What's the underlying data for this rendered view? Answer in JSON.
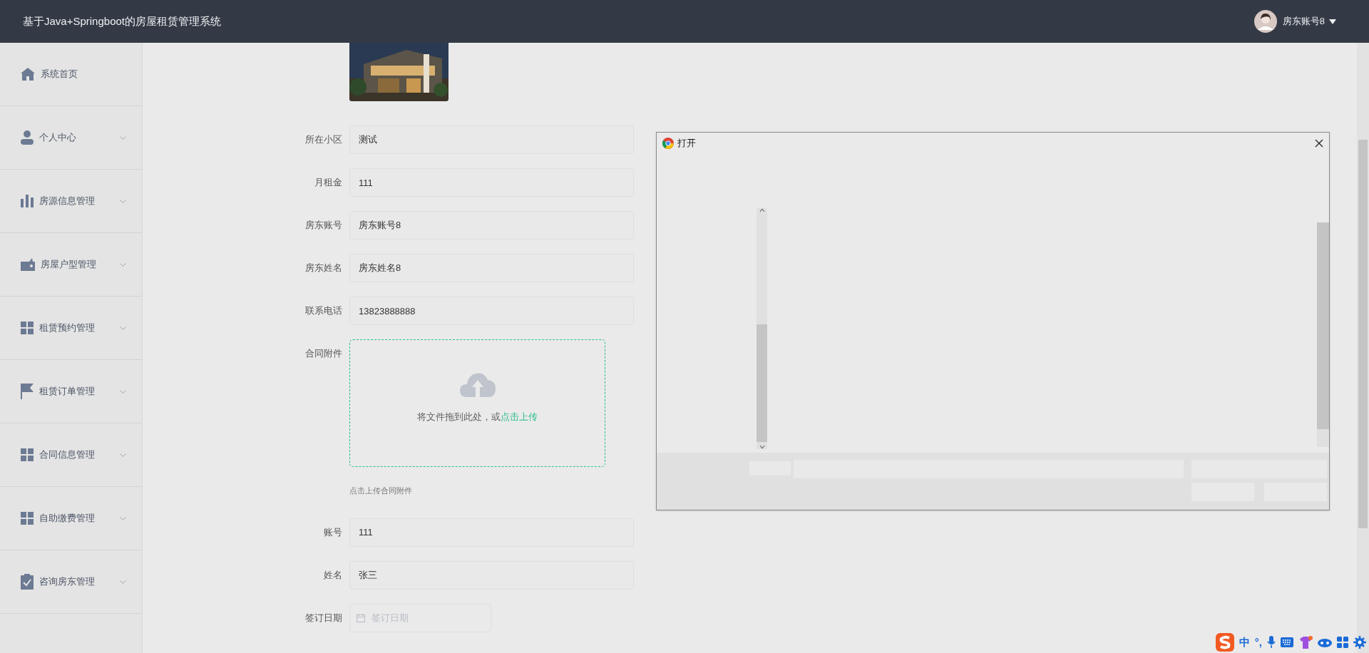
{
  "header": {
    "title": "基于Java+Springboot的房屋租赁管理系统",
    "user": "房东账号8"
  },
  "sidebar": {
    "items": [
      {
        "label": "系统首页",
        "kind": "home",
        "submenu": false
      },
      {
        "label": "个人中心",
        "kind": "user",
        "submenu": true
      },
      {
        "label": "房源信息管理",
        "kind": "chart",
        "submenu": true
      },
      {
        "label": "房屋户型管理",
        "kind": "wallet",
        "submenu": true
      },
      {
        "label": "租赁预约管理",
        "kind": "grid",
        "submenu": true
      },
      {
        "label": "租赁订单管理",
        "kind": "flag",
        "submenu": true
      },
      {
        "label": "合同信息管理",
        "kind": "grid",
        "submenu": true
      },
      {
        "label": "自助缴费管理",
        "kind": "grid",
        "submenu": true
      },
      {
        "label": "咨询房东管理",
        "kind": "clipboard",
        "submenu": true
      }
    ]
  },
  "form": {
    "fields": [
      {
        "kind": "input",
        "label": "所在小区",
        "value": "测试"
      },
      {
        "kind": "input",
        "label": "月租金",
        "value": "111"
      },
      {
        "kind": "input",
        "label": "房东账号",
        "value": "房东账号8"
      },
      {
        "kind": "input",
        "label": "房东姓名",
        "value": "房东姓名8"
      },
      {
        "kind": "input",
        "label": "联系电话",
        "value": "13823888888"
      },
      {
        "kind": "upload",
        "label": "合同附件",
        "text": "将文件拖到此处，或",
        "link": "点击上传",
        "hint": "点击上传合同附件"
      },
      {
        "kind": "input",
        "label": "账号",
        "value": "111"
      },
      {
        "kind": "input",
        "label": "姓名",
        "value": "张三"
      },
      {
        "kind": "date",
        "label": "签订日期",
        "placeholder": "签订日期"
      }
    ]
  },
  "dialog": {
    "title": "打开"
  },
  "ime_tray": {
    "items": [
      "中",
      "°,"
    ]
  }
}
